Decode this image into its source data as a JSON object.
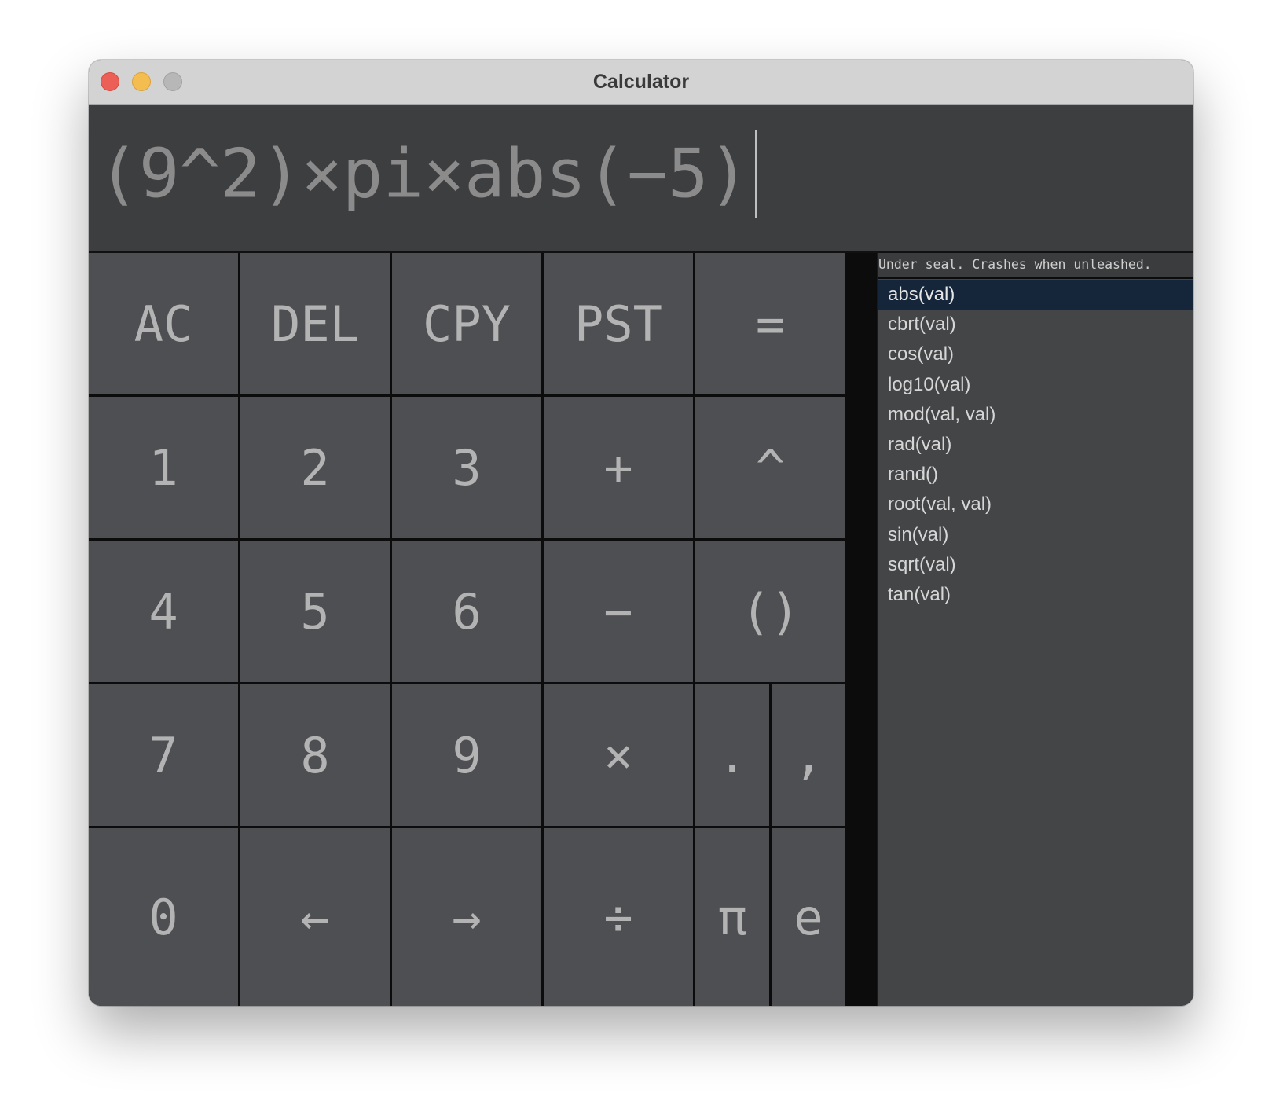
{
  "window": {
    "title": "Calculator"
  },
  "display": {
    "expression": "(9^2)×pi×abs(−5)"
  },
  "keypad": {
    "keys": [
      {
        "id": "ac",
        "label": "AC"
      },
      {
        "id": "del",
        "label": "DEL"
      },
      {
        "id": "cpy",
        "label": "CPY"
      },
      {
        "id": "pst",
        "label": "PST"
      },
      {
        "id": "equals",
        "label": "="
      },
      {
        "id": "1",
        "label": "1"
      },
      {
        "id": "2",
        "label": "2"
      },
      {
        "id": "3",
        "label": "3"
      },
      {
        "id": "plus",
        "label": "+"
      },
      {
        "id": "power",
        "label": "^"
      },
      {
        "id": "4",
        "label": "4"
      },
      {
        "id": "5",
        "label": "5"
      },
      {
        "id": "6",
        "label": "6"
      },
      {
        "id": "minus",
        "label": "−"
      },
      {
        "id": "parens",
        "label": "()"
      },
      {
        "id": "7",
        "label": "7"
      },
      {
        "id": "8",
        "label": "8"
      },
      {
        "id": "9",
        "label": "9"
      },
      {
        "id": "multiply",
        "label": "×"
      },
      {
        "id": "dot",
        "label": "."
      },
      {
        "id": "comma",
        "label": ","
      },
      {
        "id": "0",
        "label": "0"
      },
      {
        "id": "left",
        "label": "←"
      },
      {
        "id": "right",
        "label": "→"
      },
      {
        "id": "divide",
        "label": "÷"
      },
      {
        "id": "pi",
        "label": "π"
      },
      {
        "id": "e",
        "label": "e"
      }
    ]
  },
  "sidebar": {
    "hint": "Under seal. Crashes when unleashed.",
    "selected_index": 0,
    "functions": [
      "abs(val)",
      "cbrt(val)",
      "cos(val)",
      "log10(val)",
      "mod(val, val)",
      "rad(val)",
      "rand()",
      "root(val, val)",
      "sin(val)",
      "sqrt(val)",
      "tan(val)"
    ]
  }
}
